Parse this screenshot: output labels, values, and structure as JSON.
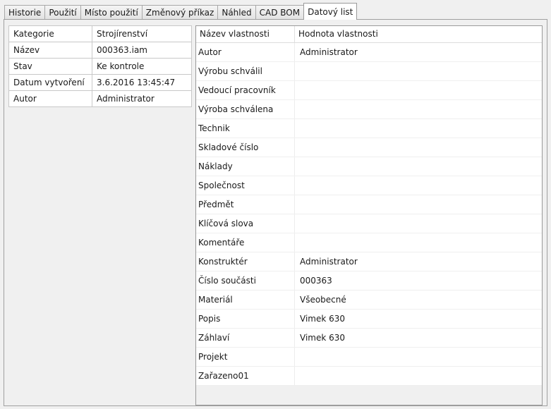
{
  "tabs": [
    {
      "label": "Historie"
    },
    {
      "label": "Použití"
    },
    {
      "label": "Místo použití"
    },
    {
      "label": "Změnový příkaz"
    },
    {
      "label": "Náhled"
    },
    {
      "label": "CAD BOM"
    },
    {
      "label": "Datový list",
      "active": true
    }
  ],
  "summary": [
    {
      "key": "Kategorie",
      "value": "Strojírenství"
    },
    {
      "key": "Název",
      "value": "000363.iam"
    },
    {
      "key": "Stav",
      "value": "Ke kontrole"
    },
    {
      "key": "Datum vytvoření",
      "value": "3.6.2016 13:45:47"
    },
    {
      "key": "Autor",
      "value": "Administrator"
    }
  ],
  "properties": {
    "columns": [
      "Název vlastnosti",
      "Hodnota vlastnosti"
    ],
    "rows": [
      {
        "name": "Autor",
        "value": "Administrator"
      },
      {
        "name": "Výrobu schválil",
        "value": ""
      },
      {
        "name": "Vedoucí pracovník",
        "value": ""
      },
      {
        "name": "Výroba schválena",
        "value": ""
      },
      {
        "name": "Technik",
        "value": ""
      },
      {
        "name": "Skladové číslo",
        "value": ""
      },
      {
        "name": "Náklady",
        "value": ""
      },
      {
        "name": "Společnost",
        "value": ""
      },
      {
        "name": "Předmět",
        "value": ""
      },
      {
        "name": "Klíčová slova",
        "value": ""
      },
      {
        "name": "Komentáře",
        "value": ""
      },
      {
        "name": "Konstruktér",
        "value": "Administrator"
      },
      {
        "name": "Číslo součásti",
        "value": "000363"
      },
      {
        "name": "Materiál",
        "value": "Všeobecné"
      },
      {
        "name": "Popis",
        "value": "Vimek 630"
      },
      {
        "name": "Záhlaví",
        "value": "Vimek 630"
      },
      {
        "name": "Projekt",
        "value": ""
      },
      {
        "name": "Zařazeno01",
        "value": ""
      }
    ]
  }
}
